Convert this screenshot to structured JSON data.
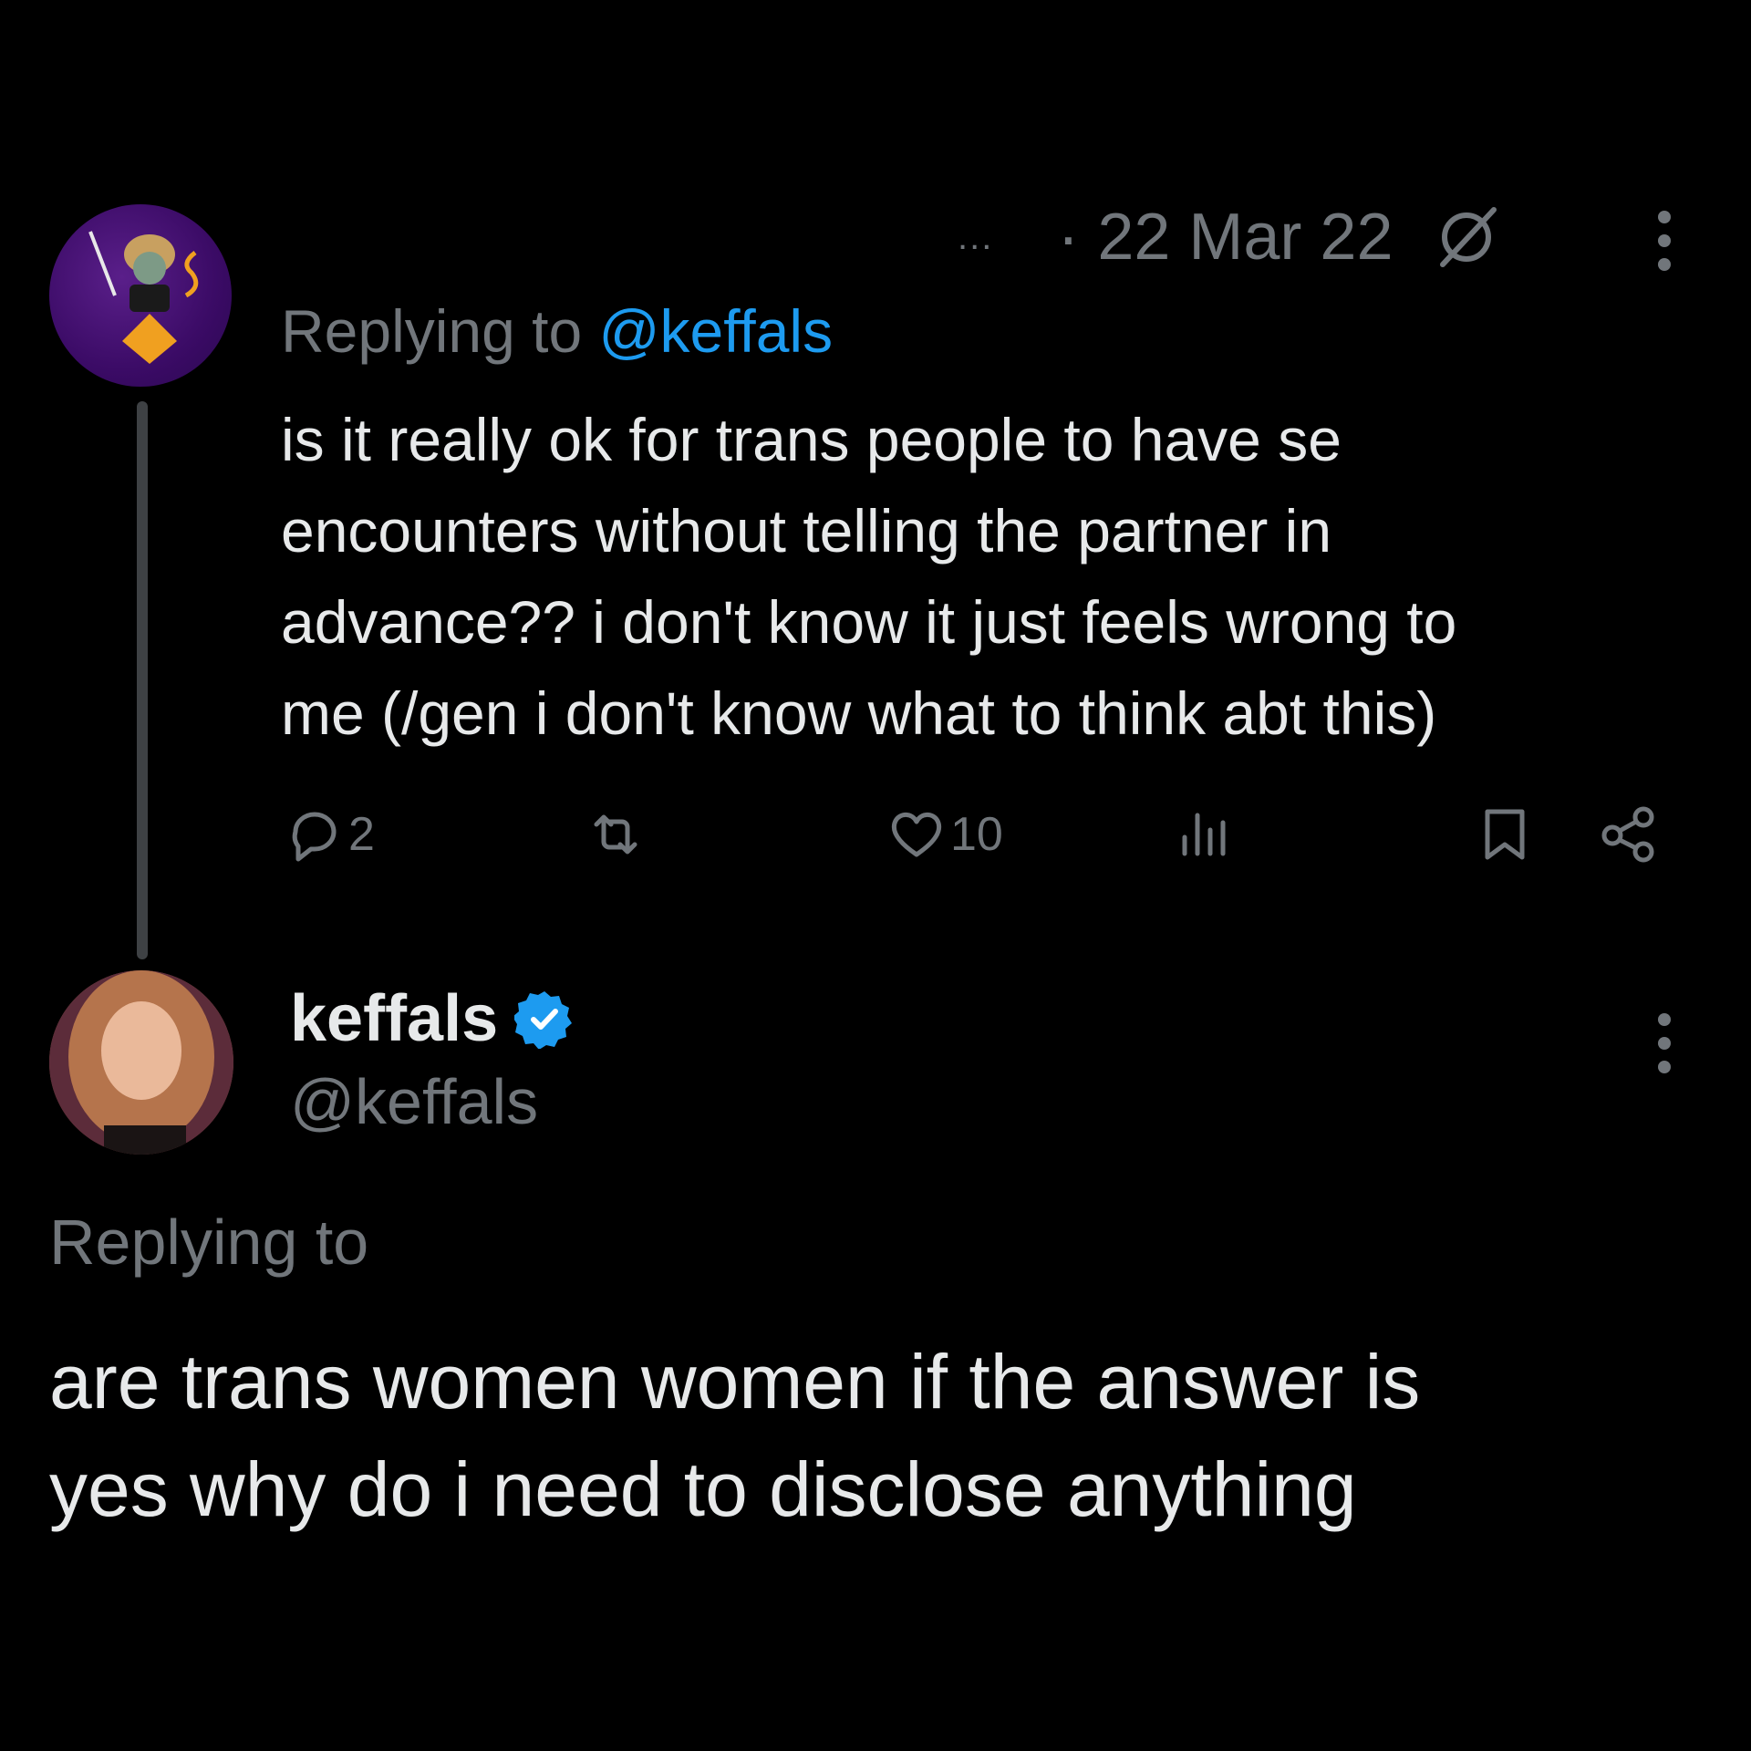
{
  "tweet1": {
    "meta": {
      "ellipsis": "...",
      "date": "· 22 Mar 22"
    },
    "replying_prefix": "Replying to ",
    "replying_mention": "@keffals",
    "text_lines": [
      "is it really ok for trans people to have se",
      "encounters without telling the partner in",
      "advance?? i don't know it just feels wrong to",
      "me (/gen i don't know what to think abt this)"
    ],
    "actions": {
      "reply_count": "2",
      "like_count": "10"
    }
  },
  "tweet2": {
    "display_name": "keffals",
    "handle": "@keffals",
    "replying_prefix": "Replying to",
    "text_lines": [
      "are trans women women if the answer is",
      "yes why do i need to disclose anything"
    ]
  },
  "colors": {
    "background": "#000000",
    "text": "#e7e9ea",
    "muted": "#71767b",
    "accent": "#1d9bf0"
  },
  "icons": [
    "edited-icon",
    "more-icon",
    "reply-icon",
    "retweet-icon",
    "like-icon",
    "views-icon",
    "bookmark-icon",
    "share-icon",
    "verified-badge-icon"
  ]
}
